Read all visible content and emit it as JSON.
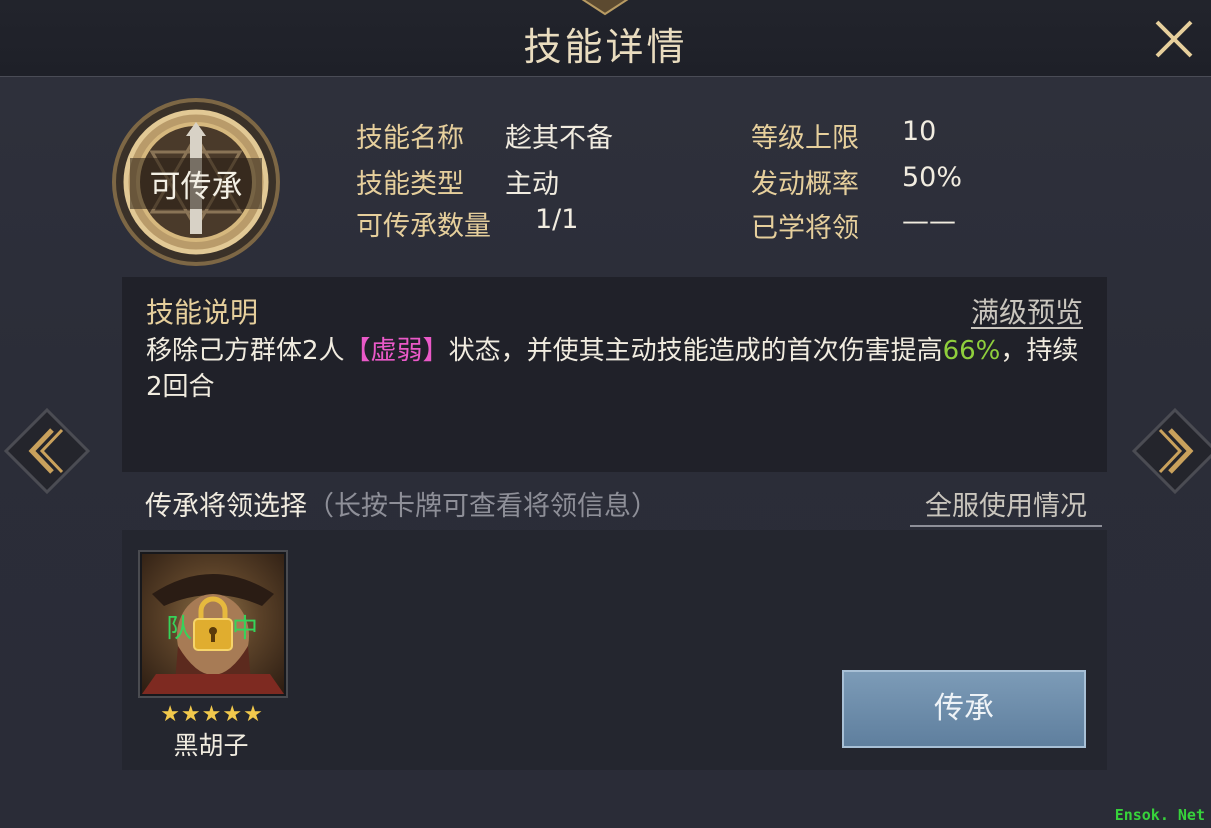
{
  "header": {
    "title": "技能详情",
    "close_icon": "close-icon"
  },
  "skill": {
    "badge": "可传承",
    "fields": [
      {
        "label": "技能名称",
        "value": "趁其不备"
      },
      {
        "label": "技能类型",
        "value": "主动"
      },
      {
        "label": "可传承数量",
        "value": "1/1"
      },
      {
        "label": "等级上限",
        "value": "10"
      },
      {
        "label": "发动概率",
        "value": "50%"
      },
      {
        "label": "已学将领",
        "value": "——"
      }
    ]
  },
  "description": {
    "heading": "技能说明",
    "full_level_preview": "满级预览",
    "text_before": "移除己方群体2人",
    "status_tag": "【虚弱】",
    "text_middle": "状态，并使其主动技能造成的首次伤害提高",
    "value": "66%",
    "text_after": "，持续2回合"
  },
  "inherit": {
    "title": "传承将领选择",
    "hint": "（长按卡牌可查看将领信息）",
    "server_usage": "全服使用情况",
    "button_label": "传承",
    "general": {
      "name": "黑胡子",
      "stars": 5,
      "stars_text": "★★★★★",
      "team_left": "队",
      "team_right": "中"
    }
  },
  "watermark": "Ensok. Net",
  "colors": {
    "gold": "#e6cf9c",
    "status_pink": "#ea59c8",
    "value_green": "#8fcf3c",
    "team_green": "#36d35a"
  }
}
